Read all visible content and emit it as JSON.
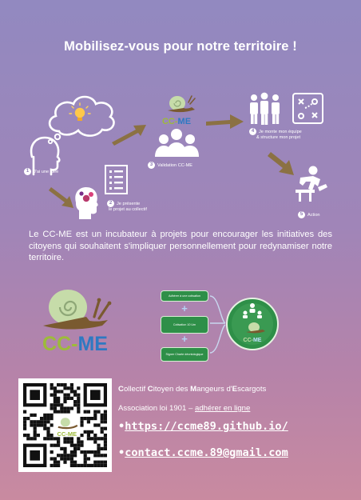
{
  "title": "Mobilisez-vous pour notre territoire !",
  "steps": [
    {
      "num": "1",
      "label": "J'ai une idée"
    },
    {
      "num": "2",
      "label_line1": "Je présente",
      "label_line2": "le projet au collectif"
    },
    {
      "num": "3",
      "label": "Validation CC-ME"
    },
    {
      "num": "4",
      "label_line1": "Je monte mon équipe",
      "label_line2": "& structure mon projet"
    },
    {
      "num": "5",
      "label": "Action"
    }
  ],
  "logo_small_text": "CC-ME",
  "description": "Le CC-ME est un incubateur à projets pour encourager les initiatives des citoyens qui souhaitent s'impliquer personnellement pour redynamiser notre territoire.",
  "logo_large_text": "CC-ME",
  "flow": {
    "boxes": [
      "Adhérer à une cotisation",
      "Cotisation 10 Um",
      "Signer Charte déontologique"
    ],
    "plus_symbol": "+",
    "result_logo_text": "CC-ME"
  },
  "qr": {
    "center_text": "CC-ME"
  },
  "association": {
    "name_initials": [
      "C",
      "C",
      "M",
      "E"
    ],
    "name_rest": [
      "ollectif ",
      "itoyen des ",
      "angeurs d'",
      "scargots"
    ],
    "type_prefix": "Association loi 1901 – ",
    "type_link": "adhérer en ligne",
    "website_bullet": "•",
    "website": "https://ccme89.github.io/",
    "email_bullet": "•",
    "email": "contact.ccme.89@gmail.com"
  },
  "colors": {
    "snail_shell": "#c6dca9",
    "snail_body": "#7a5a30",
    "logo_text_green": "#9dbb3a",
    "logo_text_blue": "#2e79c2",
    "arrow": "#8b7143",
    "flow_box": "#2e8f48"
  }
}
